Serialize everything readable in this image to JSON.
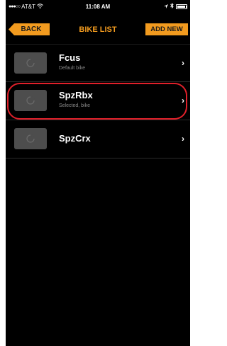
{
  "status_bar": {
    "signal": "●●●○○",
    "carrier": "AT&T",
    "wifi_icon": "wifi-icon",
    "time": "11:08 AM",
    "bluetooth_icon": "bluetooth-icon",
    "battery_icon": "battery-icon"
  },
  "nav": {
    "back_label": "BACK",
    "title": "BIKE LIST",
    "add_new_label": "ADD NEW"
  },
  "bikes": [
    {
      "name": "Fcus",
      "subtitle": "Default bike",
      "highlighted": false
    },
    {
      "name": "SpzRbx",
      "subtitle": "Selected, bike",
      "highlighted": true
    },
    {
      "name": "SpzCrx",
      "subtitle": "",
      "highlighted": false
    }
  ],
  "icons": {
    "thumb": "bike-placeholder-icon",
    "chevron": "chevron-right-icon"
  },
  "colors": {
    "accent": "#f29b1f",
    "background": "#000000",
    "highlight": "#e0202a",
    "thumb": "#4d4d4d"
  }
}
